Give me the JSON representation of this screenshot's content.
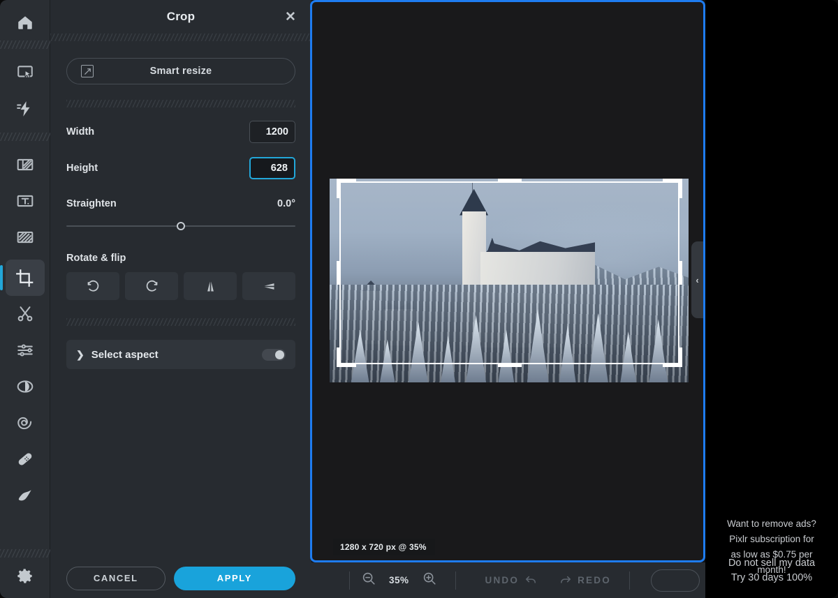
{
  "toolbar": {
    "items": [
      {
        "name": "home-icon",
        "label": "Home"
      },
      {
        "name": "arrange-icon",
        "label": "Arrange"
      },
      {
        "name": "quick-actions-icon",
        "label": "Quick actions"
      },
      {
        "name": "layout-icon",
        "label": "Layout"
      },
      {
        "name": "text-icon",
        "label": "Text"
      },
      {
        "name": "draw-icon",
        "label": "Draw"
      },
      {
        "name": "crop-icon",
        "label": "Crop"
      },
      {
        "name": "cutout-icon",
        "label": "Cutout"
      },
      {
        "name": "adjust-icon",
        "label": "Adjust"
      },
      {
        "name": "effects-icon",
        "label": "Effects"
      },
      {
        "name": "liquify-icon",
        "label": "Liquify"
      },
      {
        "name": "heal-icon",
        "label": "Heal"
      },
      {
        "name": "retouch-icon",
        "label": "Retouch"
      },
      {
        "name": "settings-icon",
        "label": "Settings"
      }
    ],
    "active": "crop-icon"
  },
  "panel": {
    "title": "Crop",
    "close_label": "✕",
    "smart_resize_label": "Smart resize",
    "width_label": "Width",
    "width_value": "1200",
    "height_label": "Height",
    "height_value": "628",
    "straighten_label": "Straighten",
    "straighten_value": "0.0°",
    "rotate_flip_label": "Rotate & flip",
    "rotate_flip_buttons": [
      {
        "name": "rotate-left-button",
        "label": "Rotate left"
      },
      {
        "name": "rotate-right-button",
        "label": "Rotate right"
      },
      {
        "name": "flip-horizontal-button",
        "label": "Flip horizontal"
      },
      {
        "name": "flip-vertical-button",
        "label": "Flip vertical"
      }
    ],
    "aspect_chevron": "❯",
    "aspect_label": "Select aspect",
    "aspect_toggle_on": false,
    "cancel_label": "CANCEL",
    "apply_label": "APPLY"
  },
  "canvas": {
    "crop_badge": "1280 x 720 px @ 35%",
    "collapse_label": "‹",
    "border_color": "#1e7cf0"
  },
  "bottom_bar": {
    "zoom_out_label": "Zoom out",
    "zoom_value": "35%",
    "zoom_in_label": "Zoom in",
    "undo_label": "UNDO",
    "redo_label": "REDO"
  },
  "ad": {
    "line1": "Want to remove ads?",
    "line2": "Pixlr subscription for",
    "line3": "as low as $0.75 per",
    "line4": "month!",
    "line5": "Do not sell my data",
    "line6": "Try 30 days 100%"
  },
  "colors": {
    "accent_blue": "#1e7cf0",
    "accent_cyan": "#22a7d9",
    "apply_blue": "#19a3db",
    "panel_bg": "#272b30",
    "toolbar_bg": "#2a2e33"
  }
}
